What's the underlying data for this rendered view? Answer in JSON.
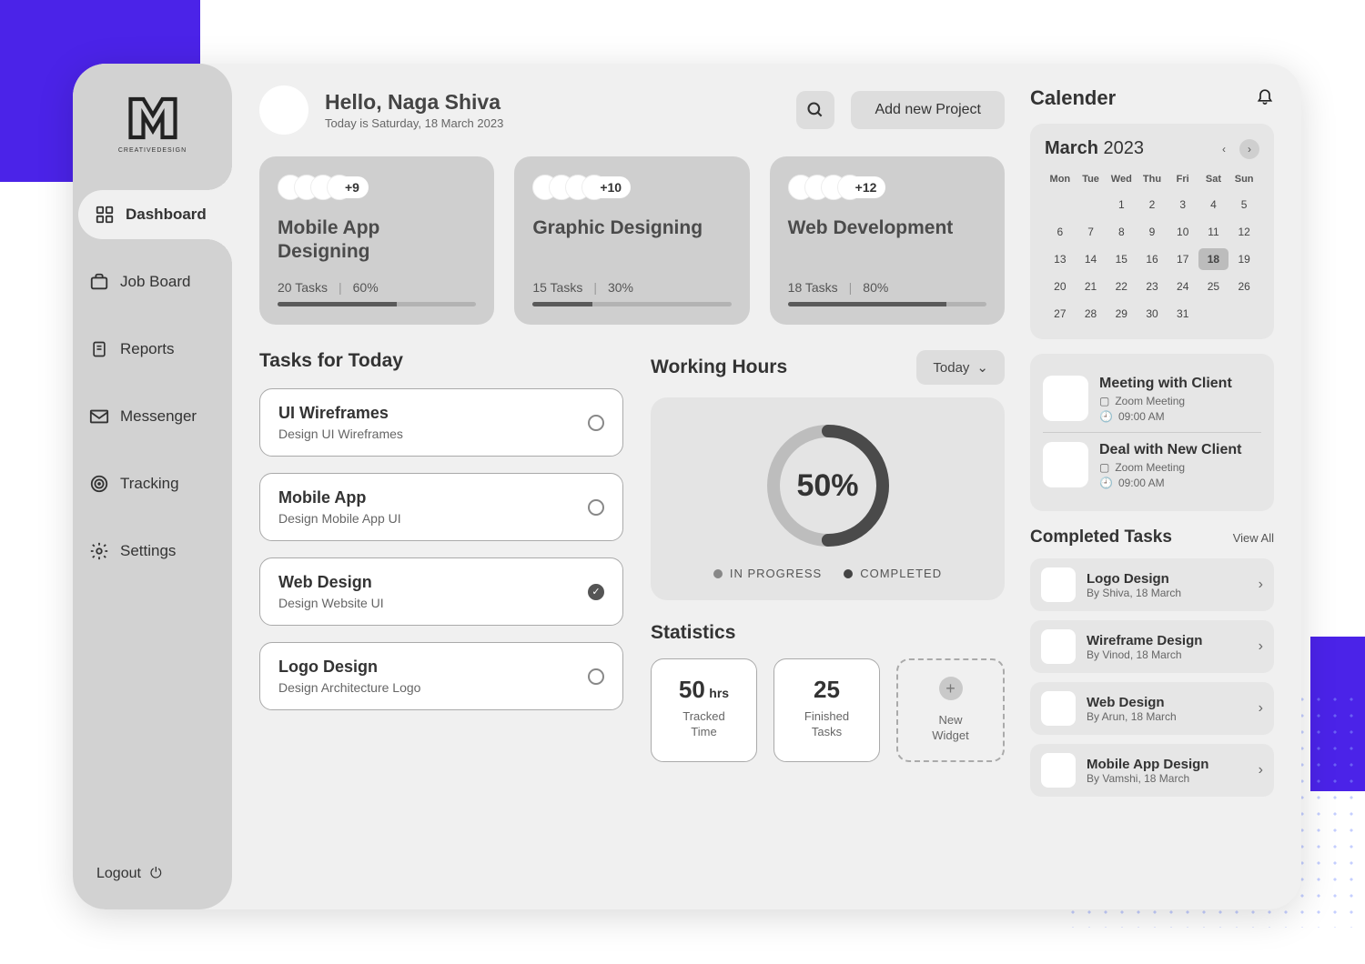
{
  "logo_sub": "CREATIVEDESIGN",
  "nav": [
    {
      "label": "Dashboard",
      "icon": "grid",
      "active": true
    },
    {
      "label": "Job Board",
      "icon": "briefcase",
      "active": false
    },
    {
      "label": "Reports",
      "icon": "doc",
      "active": false
    },
    {
      "label": "Messenger",
      "icon": "mail",
      "active": false
    },
    {
      "label": "Tracking",
      "icon": "target",
      "active": false
    },
    {
      "label": "Settings",
      "icon": "gear",
      "active": false
    }
  ],
  "logout_label": "Logout",
  "header": {
    "greeting": "Hello, Naga Shiva",
    "date_line": "Today is Saturday, 18 March 2023",
    "add_project": "Add new Project"
  },
  "projects": [
    {
      "title": "Mobile App Designing",
      "more": "+9",
      "tasks_label": "20 Tasks",
      "percent_label": "60%",
      "percent": 60
    },
    {
      "title": "Graphic Designing",
      "more": "+10",
      "tasks_label": "15 Tasks",
      "percent_label": "30%",
      "percent": 30
    },
    {
      "title": "Web Development",
      "more": "+12",
      "tasks_label": "18 Tasks",
      "percent_label": "80%",
      "percent": 80
    }
  ],
  "tasks_heading": "Tasks  for Today",
  "tasks": [
    {
      "title": "UI Wireframes",
      "sub": "Design UI Wireframes",
      "done": false
    },
    {
      "title": "Mobile App",
      "sub": "Design Mobile App UI",
      "done": false
    },
    {
      "title": "Web Design",
      "sub": "Design Website UI",
      "done": true
    },
    {
      "title": "Logo Design",
      "sub": "Design Architecture Logo",
      "done": false
    }
  ],
  "hours": {
    "heading": "Working Hours",
    "selector": "Today",
    "center": "50%",
    "progress": 50,
    "legend_in": "IN PROGRESS",
    "legend_done": "COMPLETED"
  },
  "stats": {
    "heading": "Statistics",
    "items": [
      {
        "value": "50",
        "unit": "hrs",
        "label": "Tracked Time"
      },
      {
        "value": "25",
        "unit": "",
        "label": "Finished Tasks"
      }
    ],
    "new_label": "New Widget"
  },
  "calendar": {
    "title": "Calender",
    "month": "March",
    "year": "2023",
    "days": [
      "Mon",
      "Tue",
      "Wed",
      "Thu",
      "Fri",
      "Sat",
      "Sun"
    ],
    "offset": 2,
    "count": 31,
    "selected": 18
  },
  "events": [
    {
      "title": "Meeting with Client",
      "platform": "Zoom Meeting",
      "time": "09:00 AM"
    },
    {
      "title": "Deal with New Client",
      "platform": "Zoom Meeting",
      "time": "09:00 AM"
    }
  ],
  "completed": {
    "heading": "Completed Tasks",
    "view_all": "View All",
    "items": [
      {
        "title": "Logo Design",
        "sub": "By Shiva, 18 March"
      },
      {
        "title": "Wireframe Design",
        "sub": "By Vinod, 18 March"
      },
      {
        "title": "Web Design",
        "sub": "By Arun, 18 March"
      },
      {
        "title": "Mobile App Design",
        "sub": "By Vamshi, 18 March"
      }
    ]
  }
}
